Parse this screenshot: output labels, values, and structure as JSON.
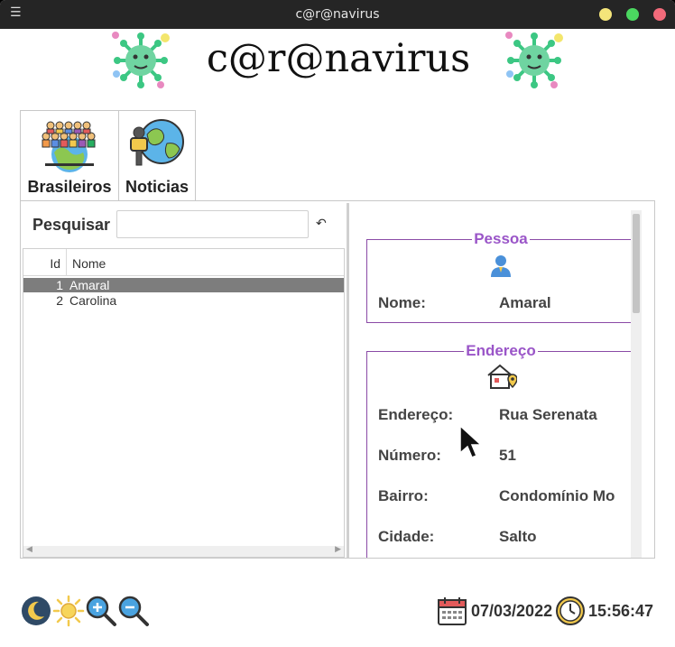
{
  "window": {
    "title": "c@r@navirus",
    "menu_icon": "hamburger-icon"
  },
  "header": {
    "title": "c@r@navirus",
    "logo_icon": "virus-icon"
  },
  "tabs": [
    {
      "label": "Brasileiros",
      "icon": "crowd-globe-icon",
      "active": true
    },
    {
      "label": "Noticias",
      "icon": "globe-microphone-icon",
      "active": false
    }
  ],
  "search": {
    "label": "Pesquisar",
    "value": "",
    "placeholder": "",
    "reset_icon": "undo-icon"
  },
  "table": {
    "columns": [
      "Id",
      "Nome"
    ],
    "rows": [
      {
        "id": "1",
        "nome": "Amaral",
        "selected": true
      },
      {
        "id": "2",
        "nome": "Carolina",
        "selected": false
      }
    ]
  },
  "pessoa": {
    "title": "Pessoa",
    "icon": "person-icon",
    "nome_label": "Nome:",
    "nome_value": "Amaral"
  },
  "endereco": {
    "title": "Endereço",
    "icon": "house-location-icon",
    "fields": [
      {
        "label": "Endereço:",
        "value": "Rua Serenata"
      },
      {
        "label": "Número:",
        "value": "51"
      },
      {
        "label": "Bairro:",
        "value": "Condomínio Mo"
      },
      {
        "label": "Cidade:",
        "value": "Salto"
      }
    ]
  },
  "footer": {
    "tools": [
      "moon-icon",
      "sun-icon",
      "zoom-in-icon",
      "zoom-out-icon"
    ],
    "date": "07/03/2022",
    "time": "15:56:47"
  },
  "colors": {
    "accent": "#9a55c8",
    "group_border": "#8a4aa6",
    "selection": "#7d7d7d",
    "titlebar": "#252525"
  }
}
